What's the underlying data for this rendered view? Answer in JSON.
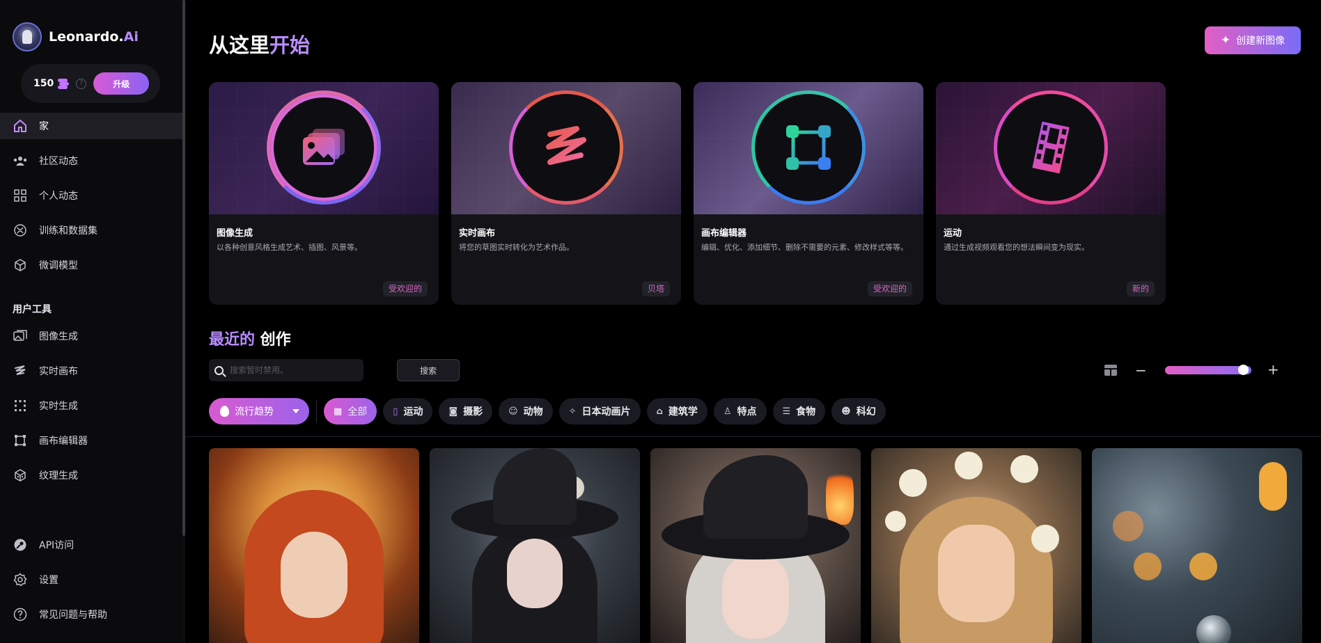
{
  "brand": {
    "name": "Leonardo.",
    "name_accent": "Ai"
  },
  "credits": {
    "count": "150",
    "upgrade_label": "升级"
  },
  "sidebar": {
    "main_items": [
      {
        "label": "家",
        "icon": "home-icon",
        "active": true
      },
      {
        "label": "社区动态",
        "icon": "community-icon"
      },
      {
        "label": "个人动态",
        "icon": "grid-icon"
      },
      {
        "label": "训练和数据集",
        "icon": "training-icon"
      },
      {
        "label": "微调模型",
        "icon": "cube-icon"
      }
    ],
    "section_title": "用户工具",
    "tool_items": [
      {
        "label": "图像生成",
        "icon": "image-gen-icon"
      },
      {
        "label": "实时画布",
        "icon": "realtime-canvas-icon"
      },
      {
        "label": "实时生成",
        "icon": "realtime-gen-icon"
      },
      {
        "label": "画布编辑器",
        "icon": "canvas-editor-icon"
      },
      {
        "label": "纹理生成",
        "icon": "texture-icon"
      }
    ],
    "bottom_items": [
      {
        "label": "API访问",
        "icon": "key-icon"
      },
      {
        "label": "设置",
        "icon": "gear-icon"
      },
      {
        "label": "常见问题与帮助",
        "icon": "help-icon"
      }
    ]
  },
  "header": {
    "title_prefix": "从这里",
    "title_accent": "开始",
    "create_button": "创建新图像"
  },
  "tools": [
    {
      "name": "图像生成",
      "desc": "以各种创意风格生成艺术、插图、风景等。",
      "badge": "受欢迎的"
    },
    {
      "name": "实时画布",
      "desc": "将您的草图实时转化为艺术作品。",
      "badge": "贝塔"
    },
    {
      "name": "画布编辑器",
      "desc": "编辑、优化、添加细节、删除不需要的元素、修改样式等等。",
      "badge": "受欢迎的"
    },
    {
      "name": "运动",
      "desc": "通过生成视频观看您的想法瞬间变为现实。",
      "badge": "新的"
    }
  ],
  "recent": {
    "title_accent": "最近的",
    "title_rest": " 创作",
    "search_placeholder": "搜索暂时禁用。",
    "search_button": "搜索",
    "zoom_level": 0.95
  },
  "filters": {
    "trend": "流行趋势",
    "chips": [
      {
        "label": "全部",
        "icon": "grid-icon",
        "active": true
      },
      {
        "label": "运动",
        "icon": "film-icon"
      },
      {
        "label": "摄影",
        "icon": "camera-icon"
      },
      {
        "label": "动物",
        "icon": "cat-icon"
      },
      {
        "label": "日本动画片",
        "icon": "sparkle-icon"
      },
      {
        "label": "建筑学",
        "icon": "building-icon"
      },
      {
        "label": "特点",
        "icon": "person-icon"
      },
      {
        "label": "食物",
        "icon": "burger-icon"
      },
      {
        "label": "科幻",
        "icon": "alien-icon"
      }
    ]
  }
}
